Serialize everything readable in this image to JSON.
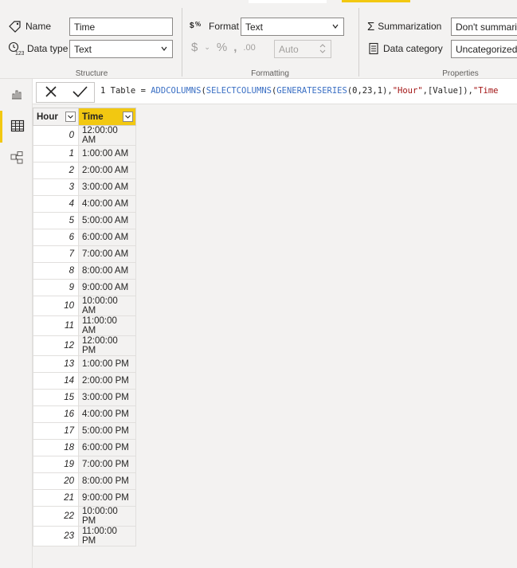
{
  "ribbon": {
    "structure": {
      "name_label": "Name",
      "name_value": "Time",
      "data_type_label": "Data type",
      "data_type_value": "Text",
      "group_label": "Structure"
    },
    "formatting": {
      "format_label": "Format",
      "format_value": "Text",
      "auto_placeholder": "Auto",
      "group_label": "Formatting"
    },
    "properties": {
      "summarization_label": "Summarization",
      "summarization_value": "Don't summari",
      "data_category_label": "Data category",
      "data_category_value": "Uncategorized",
      "group_label": "Properties"
    }
  },
  "formula": {
    "line_number": "1",
    "prefix": " Table = ",
    "fn1": "ADDCOLUMNS",
    "p1": "(",
    "fn2": "SELECTCOLUMNS",
    "p2": "(",
    "fn3": "GENERATESERIES",
    "args": "(0,23,1),",
    "str1": "\"Hour\"",
    "mid": ",[Value]),",
    "str2": "\"Time"
  },
  "table": {
    "headers": [
      "Hour",
      "Time"
    ],
    "rows": [
      [
        "0",
        "12:00:00 AM"
      ],
      [
        "1",
        "1:00:00 AM"
      ],
      [
        "2",
        "2:00:00 AM"
      ],
      [
        "3",
        "3:00:00 AM"
      ],
      [
        "4",
        "4:00:00 AM"
      ],
      [
        "5",
        "5:00:00 AM"
      ],
      [
        "6",
        "6:00:00 AM"
      ],
      [
        "7",
        "7:00:00 AM"
      ],
      [
        "8",
        "8:00:00 AM"
      ],
      [
        "9",
        "9:00:00 AM"
      ],
      [
        "10",
        "10:00:00 AM"
      ],
      [
        "11",
        "11:00:00 AM"
      ],
      [
        "12",
        "12:00:00 PM"
      ],
      [
        "13",
        "1:00:00 PM"
      ],
      [
        "14",
        "2:00:00 PM"
      ],
      [
        "15",
        "3:00:00 PM"
      ],
      [
        "16",
        "4:00:00 PM"
      ],
      [
        "17",
        "5:00:00 PM"
      ],
      [
        "18",
        "6:00:00 PM"
      ],
      [
        "19",
        "7:00:00 PM"
      ],
      [
        "20",
        "8:00:00 PM"
      ],
      [
        "21",
        "9:00:00 PM"
      ],
      [
        "22",
        "10:00:00 PM"
      ],
      [
        "23",
        "11:00:00 PM"
      ]
    ]
  },
  "colors": {
    "accent": "#f2c811",
    "function": "#3a6fc4",
    "string": "#a31515"
  },
  "icons": {
    "name": "tag-icon",
    "data_type": "clock-123-icon",
    "format": "dollar-percent-icon",
    "summarization": "sigma-icon",
    "data_category": "category-icon",
    "report_view": "bar-chart-icon",
    "data_view": "table-grid-icon",
    "model_view": "model-icon",
    "cancel": "close-icon",
    "commit": "check-icon",
    "filter": "chevron-down-icon"
  }
}
